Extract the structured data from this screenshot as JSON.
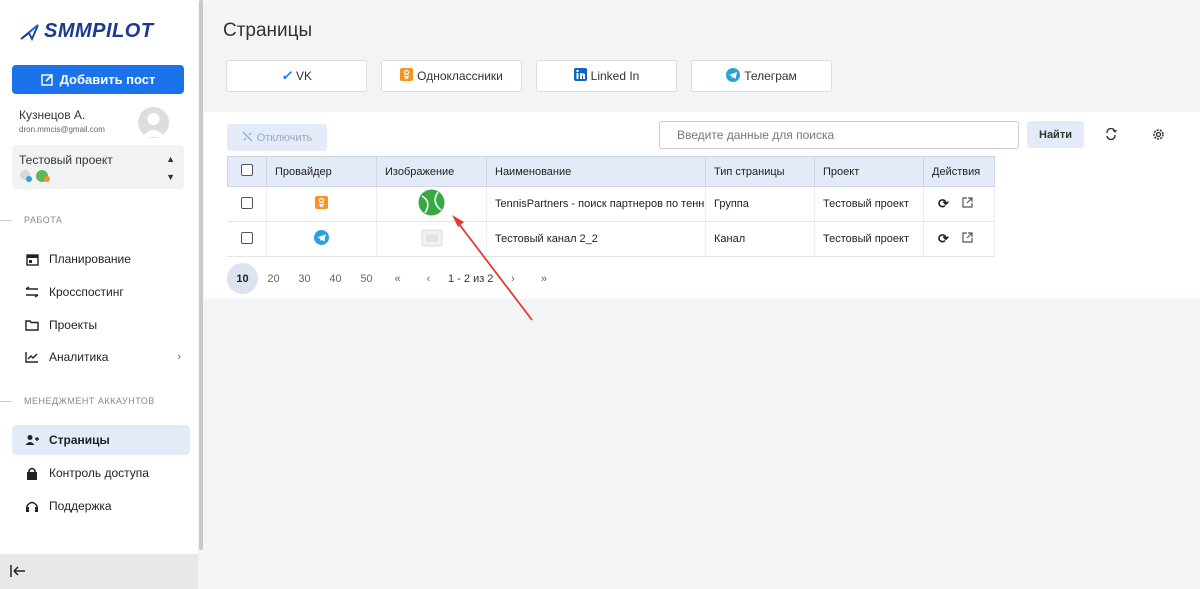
{
  "sidebar": {
    "logo_text": "SMMPILOT",
    "add_post_label": "Добавить пост",
    "user_name": "Кузнецов А.",
    "user_email": "dron.mmcis@gmail.com",
    "project_name": "Тестовый проект",
    "section_work": "РАБОТА",
    "section_accounts": "МЕНЕДЖМЕНТ АККАУНТОВ",
    "items": [
      {
        "label": "Планирование",
        "icon": "calendar-icon"
      },
      {
        "label": "Кросспостинг",
        "icon": "arrows-icon"
      },
      {
        "label": "Проекты",
        "icon": "folder-icon"
      },
      {
        "label": "Аналитика",
        "icon": "chart-icon"
      },
      {
        "label": "Страницы",
        "icon": "person-add-icon"
      },
      {
        "label": "Контроль доступа",
        "icon": "lock-icon"
      },
      {
        "label": "Поддержка",
        "icon": "headset-icon"
      }
    ]
  },
  "main": {
    "title": "Страницы",
    "provider_tabs": [
      {
        "label": "VK",
        "icon": "vk-icon"
      },
      {
        "label": "Одноклассники",
        "icon": "ok-icon"
      },
      {
        "label": "Linked In",
        "icon": "linkedin-icon"
      },
      {
        "label": "Телеграм",
        "icon": "telegram-icon"
      }
    ],
    "disconnect_label": "Отключить",
    "search_placeholder": "Введите данные для поиска",
    "find_label": "Найти"
  },
  "table": {
    "headers": [
      "Провайдер",
      "Изображение",
      "Наименование",
      "Тип страницы",
      "Проект",
      "Действия"
    ],
    "rows": [
      {
        "provider": "ok-icon",
        "name": "TennisPartners - поиск партнеров по тенн",
        "type": "Группа",
        "project": "Тестовый проект"
      },
      {
        "provider": "telegram-icon",
        "name": "Тестовый канал 2_2",
        "type": "Канал",
        "project": "Тестовый проект"
      }
    ]
  },
  "pagination": {
    "sizes": [
      "10",
      "20",
      "30",
      "40",
      "50"
    ],
    "selected": "10",
    "range": "1 - 2 из 2"
  },
  "colors": {
    "accent": "#1a73e8",
    "ok": "#f7931e",
    "telegram": "#2aa1da",
    "vk": "#0077ff",
    "linkedin": "#0a66c2",
    "arrow": "#e53935"
  }
}
